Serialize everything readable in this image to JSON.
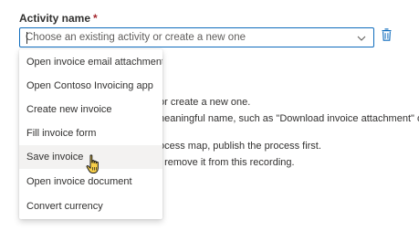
{
  "field": {
    "label": "Activity name",
    "required_mark": "*",
    "placeholder": "Choose an existing activity or create a new one"
  },
  "background_text": {
    "line1": "or create a new one.",
    "line2": "neaningful name, such as \"Download invoice attachment\" or",
    "line3": "ocess map, publish the process first.",
    "line4": "/ remove it from this recording."
  },
  "dropdown": {
    "options": [
      {
        "label": "Open invoice email attachment"
      },
      {
        "label": "Open Contoso Invoicing app"
      },
      {
        "label": "Create new invoice"
      },
      {
        "label": "Fill invoice form"
      },
      {
        "label": "Save invoice"
      },
      {
        "label": "Open invoice document"
      },
      {
        "label": "Convert currency"
      }
    ],
    "hovered_index": 4
  },
  "icons": {
    "chevron": "chevron-down-icon",
    "delete": "trash-icon",
    "cursor": "hand-pointer-cursor"
  },
  "colors": {
    "focus_border": "#0f6cbd",
    "required": "#a4262c",
    "trash": "#0f6cbd",
    "hover_bg": "#f3f2f1",
    "cursor_fill": "#f7cf4a"
  }
}
